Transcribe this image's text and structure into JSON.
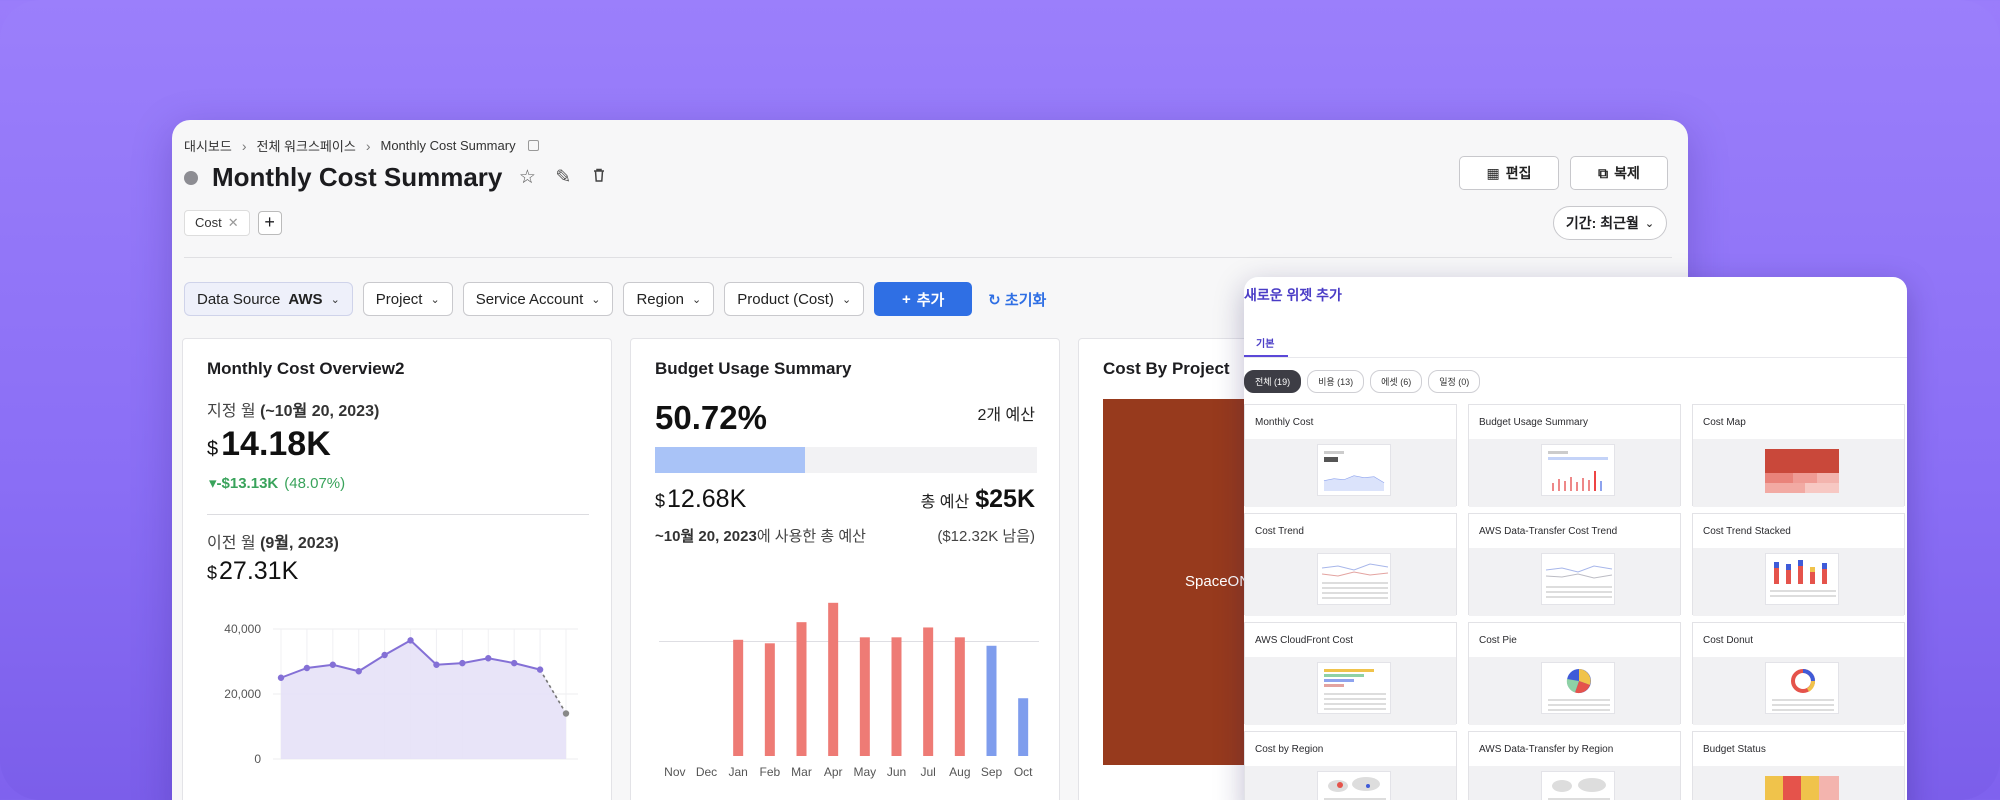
{
  "breadcrumb": [
    "대시보드",
    "전체 워크스페이스",
    "Monthly Cost Summary"
  ],
  "page_title": "Monthly Cost Summary",
  "tags": [
    "Cost"
  ],
  "actions": {
    "edit": "편집",
    "clone": "복제"
  },
  "period": "기간: 최근월",
  "filters": {
    "data_source_label": "Data Source",
    "data_source_value": "AWS",
    "project": "Project",
    "service_account": "Service Account",
    "region": "Region",
    "product": "Product (Cost)",
    "add": "추가",
    "reset": "초기화"
  },
  "overview": {
    "title": "Monthly Cost Overview2",
    "current_label_prefix": "지정 월 ",
    "current_label_bold": "(~10월 20, 2023)",
    "currency": "$",
    "current_value": "14.18K",
    "delta_value": "-$13.13K",
    "delta_pct": "(48.07%)",
    "prev_label_prefix": "이전 월 ",
    "prev_label_bold": "(9월, 2023)",
    "prev_value": "27.31K"
  },
  "budget": {
    "title": "Budget Usage Summary",
    "percent": "50.72%",
    "budget_count": "2개 예산",
    "used_value": "12.68K",
    "total_label": "총 예산",
    "total_value": "$25K",
    "used_desc_bold": "~10월 20, 2023",
    "used_desc_rest": "에 사용한 총 예산",
    "remaining": "($12.32K 남음)",
    "usage_fraction": 0.3935
  },
  "cost_by_project": {
    "title": "Cost By Project",
    "label": "SpaceONE S"
  },
  "widget_panel": {
    "title": "새로운 위젯 추가",
    "tab": "기본",
    "chips": [
      "전체 (19)",
      "비용 (13)",
      "에셋 (6)",
      "일정 (0)"
    ],
    "widgets": [
      "Monthly Cost",
      "Budget Usage Summary",
      "Cost Map",
      "Cost Trend",
      "AWS Data-Transfer Cost Trend",
      "Cost Trend Stacked",
      "AWS CloudFront Cost",
      "Cost Pie",
      "Cost Donut",
      "Cost by Region",
      "AWS Data-Transfer by Region",
      "Budget Status"
    ]
  },
  "colors": {
    "accent": "#2f6fe4",
    "purple_bg": "#8a6ef5",
    "positive": "#39a35b",
    "bar_actual": "#ee7b75",
    "bar_current": "#7f9ded",
    "project_color": "#973a1d",
    "line_color": "#8470d6"
  },
  "chart_data": [
    {
      "type": "area",
      "yticks": [
        "40,000",
        "20,000",
        "0"
      ],
      "ylim": [
        0,
        40000
      ],
      "values": [
        25000,
        28000,
        29000,
        27000,
        32000,
        36500,
        29000,
        29500,
        31000,
        29500,
        27500,
        14000
      ],
      "dashed_last": true
    },
    {
      "type": "bar",
      "categories": [
        "Nov",
        "Dec",
        "Jan",
        "Feb",
        "Mar",
        "Apr",
        "May",
        "Jun",
        "Jul",
        "Aug",
        "Sep",
        "Oct"
      ],
      "values": [
        0,
        0,
        3300,
        3200,
        3800,
        4350,
        3370,
        3370,
        3650,
        3370,
        3130,
        1640
      ],
      "ylim": [
        0,
        4600
      ],
      "budget_line": 3250,
      "current_from_index": 10
    }
  ]
}
